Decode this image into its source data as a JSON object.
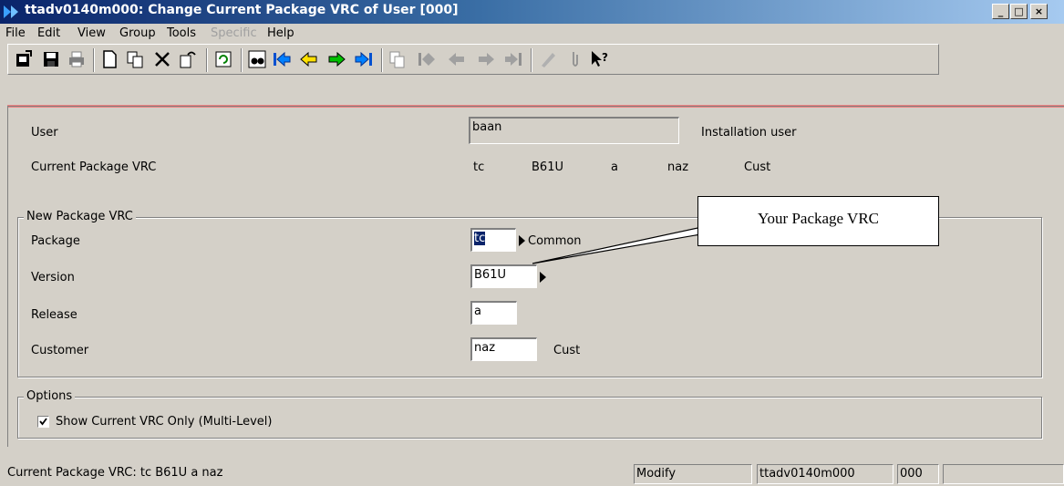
{
  "window": {
    "title": "ttadv0140m000: Change Current Package VRC of User [000]",
    "controls": {
      "minimize": "_",
      "maximize": "□",
      "close": "×"
    }
  },
  "menu": {
    "items": [
      {
        "label": "File",
        "enabled": true
      },
      {
        "label": "Edit",
        "enabled": true
      },
      {
        "label": "View",
        "enabled": true
      },
      {
        "label": "Group",
        "enabled": true
      },
      {
        "label": "Tools",
        "enabled": true
      },
      {
        "label": "Specific",
        "enabled": false
      },
      {
        "label": "Help",
        "enabled": true
      }
    ]
  },
  "toolbar": {
    "buttons": [
      "open-session-icon",
      "save-icon",
      "print-icon",
      "new-record-icon",
      "duplicate-icon",
      "delete-icon",
      "undo-icon",
      "refresh-icon",
      "find-icon",
      "first-record-icon",
      "previous-record-icon",
      "next-record-icon",
      "last-record-icon",
      "group-copy-icon",
      "group-first-icon",
      "group-previous-icon",
      "group-next-icon",
      "group-last-icon",
      "edit-text-icon",
      "attachment-icon",
      "context-help-icon"
    ]
  },
  "form": {
    "user": {
      "label": "User",
      "value": "baan",
      "description": "Installation user"
    },
    "current_vrc": {
      "label": "Current Package VRC",
      "package": "tc",
      "version": "B61U",
      "release": "a",
      "customer": "naz",
      "customer_desc": "Cust"
    },
    "new_vrc": {
      "legend": "New Package VRC",
      "package": {
        "label": "Package",
        "value": "tc",
        "description": "Common"
      },
      "version": {
        "label": "Version",
        "value": "B61U"
      },
      "release": {
        "label": "Release",
        "value": "a"
      },
      "customer": {
        "label": "Customer",
        "value": "naz",
        "description": "Cust"
      }
    },
    "options": {
      "legend": "Options",
      "show_current_only": {
        "label": "Show Current VRC Only (Multi-Level)",
        "checked": true
      }
    }
  },
  "callout": {
    "text": "Your Package VRC"
  },
  "statusbar": {
    "message": "Current Package VRC: tc B61U a  naz",
    "mode": "Modify",
    "session": "ttadv0140m000",
    "company": "000"
  },
  "colors": {
    "accent_red": "#f08080",
    "title_blue": "#0a246a",
    "selection": "#0a246a"
  }
}
